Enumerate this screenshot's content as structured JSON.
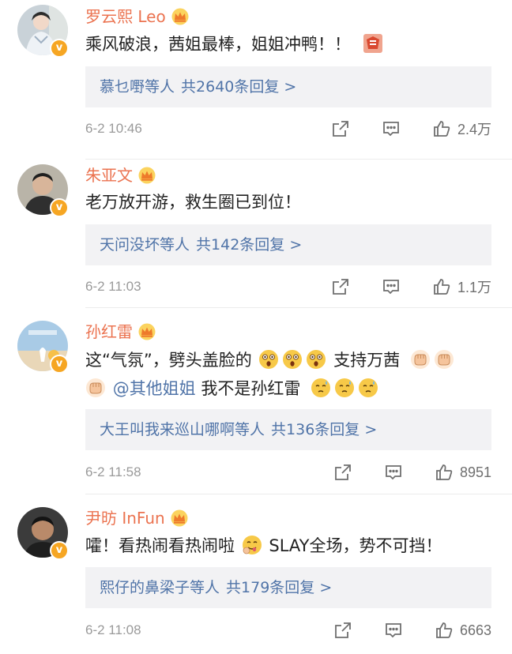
{
  "comments": [
    {
      "name": "罗云熙 Leo",
      "text_segments": [
        "乘风破浪，茜姐最棒，姐姐冲鸭！！"
      ],
      "emojis_inline": [
        "zan-emoji"
      ],
      "reply": {
        "who": "慕乜嘢",
        "dengren": "等人",
        "count": "共2640条回复 >"
      },
      "time": "6-2 10:46",
      "likes": "2.4万"
    },
    {
      "name": "朱亚文",
      "text_segments": [
        "老万放开游，救生圈已到位！"
      ],
      "reply": {
        "who": "天问没坏",
        "dengren": "等人",
        "count": "共142条回复 >"
      },
      "time": "6-2 11:03",
      "likes": "1.1万"
    },
    {
      "name": "孙红雷",
      "line1_a": "这“气氛”，劈头盖脸的",
      "line1_b": "支持万茜",
      "line2_mention": "@其他姐姐",
      "line2_text": " 我不是孙红雷",
      "reply": {
        "who": "大王叫我来巡山哪啊",
        "dengren": "等人",
        "count": "共136条回复 >"
      },
      "time": "6-2 11:58",
      "likes": "8951"
    },
    {
      "name": "尹昉 InFun",
      "text_a": "嚯！看热闹看热闹啦",
      "text_b": "SLAY全场，势不可挡！",
      "reply": {
        "who": "熙仔的鼻梁子",
        "dengren": "等人",
        "count": "共179条回复 >"
      },
      "time": "6-2 11:08",
      "likes": "6663"
    }
  ],
  "icons": {
    "verified": "verified-badge-icon",
    "crown": "crown-icon",
    "share": "share-icon",
    "comment": "comment-icon",
    "like": "like-icon"
  },
  "colors": {
    "name": "#eb7350",
    "link": "#5074a8",
    "reply_bg": "#f2f2f4",
    "badge": "#f6a623"
  },
  "badge_char": "v"
}
